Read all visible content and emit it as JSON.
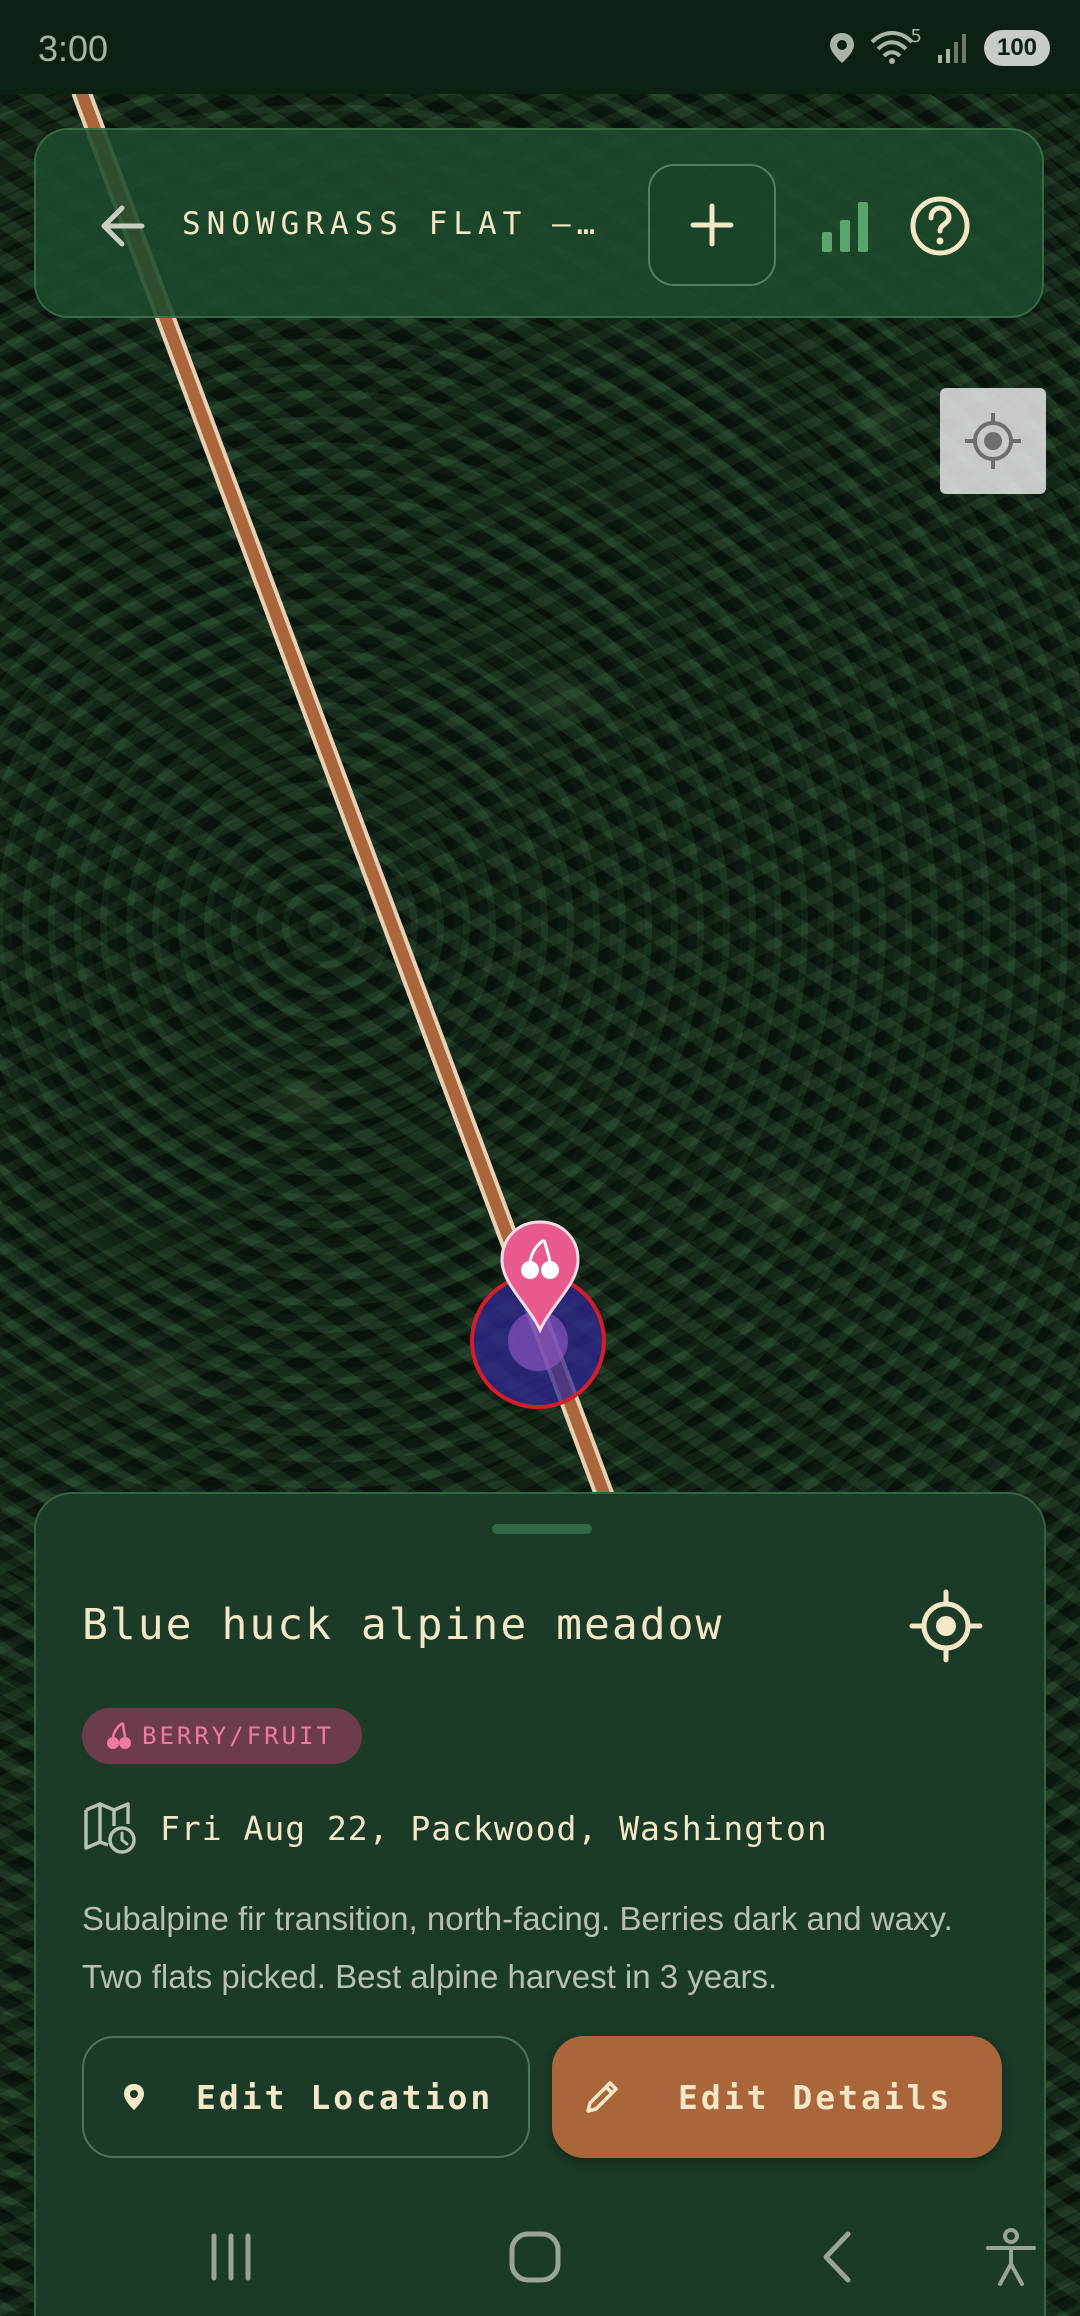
{
  "status_bar": {
    "time": "3:00",
    "wifi_badge": "5",
    "battery": "100",
    "icons": [
      "location-icon",
      "wifi-icon",
      "signal-icon"
    ]
  },
  "top_bar": {
    "title": "SNOWGRASS FLAT –…",
    "icons": [
      "back-arrow-icon",
      "plus-icon",
      "bar-chart-icon",
      "help-circle-icon"
    ]
  },
  "map": {
    "layer": "satellite",
    "marker_icon": "cherry-icon",
    "colors": {
      "trail": "#a9663a",
      "trail_edge": "#e7d0b3",
      "marker": "#e85a8e",
      "ring": "#d31e2a"
    }
  },
  "sheet": {
    "title": "Blue huck alpine meadow",
    "category": "BERRY/FRUIT",
    "category_icon": "cherry-icon",
    "date_location": "Fri Aug 22, Packwood, Washington",
    "notes": "Subalpine fir transition, north-facing. Berries dark and waxy. Two flats picked. Best alpine harvest in 3 years.",
    "edit_location_label": "Edit Location",
    "edit_details_label": "Edit Details",
    "colors": {
      "sheet_bg": "#1b3a28",
      "title": "#f3e7c8",
      "accent": "#a9663a",
      "category_bg": "#6b3d4b",
      "category_text": "#f27aa1"
    }
  },
  "nav_bar": {
    "icons": [
      "recent-apps-icon",
      "home-icon",
      "back-icon",
      "accessibility-icon"
    ]
  }
}
